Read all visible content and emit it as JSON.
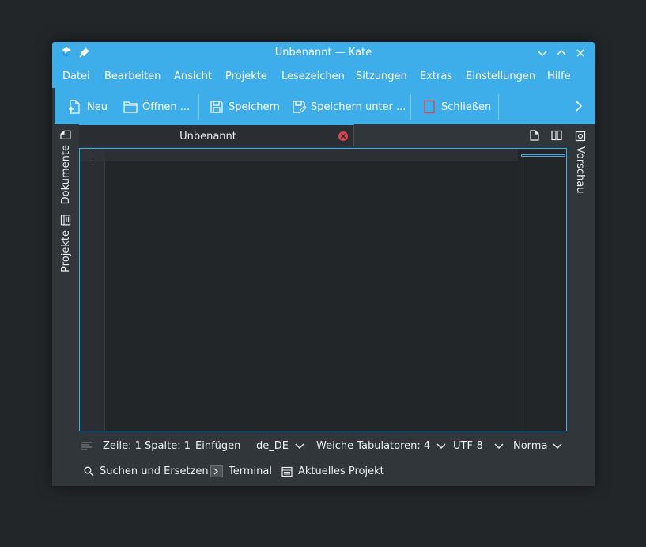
{
  "window": {
    "title": "Unbenannt — Kate"
  },
  "menu": [
    "Datei",
    "Bearbeiten",
    "Ansicht",
    "Projekte",
    "Lesezeichen",
    "Sitzungen",
    "Extras",
    "Einstellungen",
    "Hilfe"
  ],
  "toolbar": {
    "new_label": "Neu",
    "open_label": "Öffnen ...",
    "save_label": "Speichern",
    "save_as_label": "Speichern unter ...",
    "close_label": "Schließen"
  },
  "left_sidebar": {
    "documents_label": "Dokumente",
    "projects_label": "Projekte"
  },
  "right_sidebar": {
    "preview_label": "Vorschau"
  },
  "tabs": [
    {
      "label": "Unbenannt"
    }
  ],
  "status": {
    "position": "Zeile: 1 Spalte: 1",
    "mode": "Einfügen",
    "language": "de_DE",
    "indent": "Weiche Tabulatoren: 4",
    "encoding": "UTF-8",
    "syntax": "Normal"
  },
  "bottom_panels": {
    "search_label": "Suchen und Ersetzen",
    "terminal_label": "Terminal",
    "project_label": "Aktuelles Projekt"
  },
  "colors": {
    "accent": "#3daee9",
    "background": "#31363b",
    "editor": "#232629",
    "close_red": "#da4453"
  },
  "icons": [
    "kate-app-icon",
    "pin-icon",
    "minimize-icon",
    "maximize-icon",
    "close-icon",
    "new-document-icon",
    "folder-open-icon",
    "save-icon",
    "save-as-icon",
    "close-document-icon",
    "chevron-right-icon",
    "document-icon",
    "project-icon",
    "preview-icon",
    "tab-close-icon",
    "split-view-icon",
    "search-icon",
    "terminal-icon",
    "list-icon"
  ]
}
